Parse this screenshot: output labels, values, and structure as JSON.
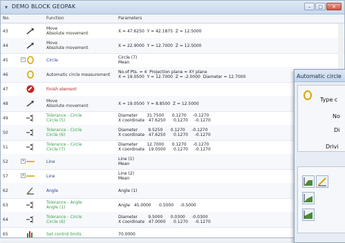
{
  "window": {
    "title": "DEMO BLOCK GEOPAK"
  },
  "header": {
    "no": "No.",
    "function": "Function",
    "parameters": "Parameters"
  },
  "rows": [
    {
      "no": "43",
      "icon": "move-arrow-icon",
      "fn1": "Move",
      "fn2": "Absolute movement",
      "fnclass": "fn-dark",
      "p1": "X = 47.6250  Y = 42.1875  Z = 12.5000",
      "p2": "",
      "pclass": "",
      "exp": ""
    },
    {
      "no": "44",
      "icon": "move-arrow-icon",
      "fn1": "Move",
      "fn2": "Absolute movement",
      "fnclass": "fn-dark",
      "p1": "X = 22.9000  Y = 12.7000  Z = 12.5000",
      "p2": "",
      "pclass": "",
      "exp": ""
    },
    {
      "no": "45",
      "icon": "circle-icon",
      "fn1": "Circle",
      "fn2": "",
      "fnclass": "fn-blue",
      "p1": "Circle (7)",
      "p2": "Mean",
      "pclass": "par-blue",
      "exp": "−"
    },
    {
      "no": "46",
      "icon": "circle-icon",
      "fn1": "Automatic circle measurement",
      "fn2": "",
      "fnclass": "fn-dark",
      "p1": "No.of Pts. = 4  Projection plane = XY plane",
      "p2": "X = 19.0500  Y = 12.7000  Z = -2.0000  Diameter = 12.7000",
      "pclass": "",
      "exp": ""
    },
    {
      "no": "47",
      "icon": "finish-icon",
      "fn1": "Finish element",
      "fn2": "",
      "fnclass": "fn-red",
      "p1": "",
      "p2": "",
      "pclass": "",
      "exp": ""
    },
    {
      "no": "48",
      "icon": "move-arrow-icon",
      "fn1": "Move",
      "fn2": "Absolute movement",
      "fnclass": "fn-dark",
      "p1": "X = 19.0500  Y = 8.8500  Z = 12.5000",
      "p2": "",
      "pclass": "",
      "exp": ""
    },
    {
      "no": "49",
      "icon": "tolerance-icon",
      "fn1": "Tolerance - Circle",
      "fn2": "Circle (5)",
      "fnclass": "fn-green",
      "p1": "Diameter       31.7500      0.1270     -0.1270",
      "p2": "X coordinate   47.6250      0.1270     -0.1270",
      "pclass": "par-green",
      "exp": ""
    },
    {
      "no": "50",
      "icon": "tolerance-icon",
      "fn1": "Tolerance - Circle",
      "fn2": "Circle (6)",
      "fnclass": "fn-green",
      "p1": "Diameter        9.5250      0.1270     -0.1270",
      "p2": "X coordinate   47.6250      0.1270     -0.1270",
      "pclass": "par-green",
      "exp": ""
    },
    {
      "no": "51",
      "icon": "tolerance-icon",
      "fn1": "Tolerance - Circle",
      "fn2": "Circle (7)",
      "fnclass": "fn-green",
      "p1": "Diameter       12.7000      0.1270     -0.1270",
      "p2": "X coordinate   19.0500      0.1270     -0.1270",
      "pclass": "par-green",
      "exp": ""
    },
    {
      "no": "52",
      "icon": "line-icon",
      "fn1": "Line",
      "fn2": "",
      "fnclass": "fn-blue",
      "p1": "Line (1)",
      "p2": "Mean",
      "pclass": "par-blue",
      "exp": "+"
    },
    {
      "no": "57",
      "icon": "line-icon",
      "fn1": "Line",
      "fn2": "",
      "fnclass": "fn-blue",
      "p1": "Line (2)",
      "p2": "Mean",
      "pclass": "par-blue",
      "exp": "+"
    },
    {
      "no": "62",
      "icon": "angle-icon",
      "fn1": "Angle",
      "fn2": "",
      "fnclass": "fn-blue",
      "p1": "Angle (1)",
      "p2": "",
      "pclass": "par-blue",
      "exp": ""
    },
    {
      "no": "63",
      "icon": "tolerance-icon",
      "fn1": "Tolerance - Angle",
      "fn2": "Angle (1)",
      "fnclass": "fn-green",
      "p1": "Angle   45.0000      0.5000     -0.5000",
      "p2": "",
      "pclass": "par-green",
      "exp": ""
    },
    {
      "no": "64",
      "icon": "tolerance-icon",
      "fn1": "Tolerance - Circle",
      "fn2": "Circle (6)",
      "fnclass": "fn-green",
      "p1": "Diameter        9.5000      0.0300     -0.0300",
      "p2": "X coordinate   47.0000      0.1270     -0.1270",
      "pclass": "par-green",
      "exp": ""
    },
    {
      "no": "65",
      "icon": "control-limits-icon",
      "fn1": "Set control limits",
      "fn2": "",
      "fnclass": "fn-green",
      "p1": "70.0000",
      "p2": "",
      "pclass": "par-green",
      "exp": ""
    }
  ],
  "dialog": {
    "title": "Automatic circle",
    "label_type": "Type c",
    "label_no": "No",
    "label_di": "Di",
    "label_drive": "Drivi"
  }
}
